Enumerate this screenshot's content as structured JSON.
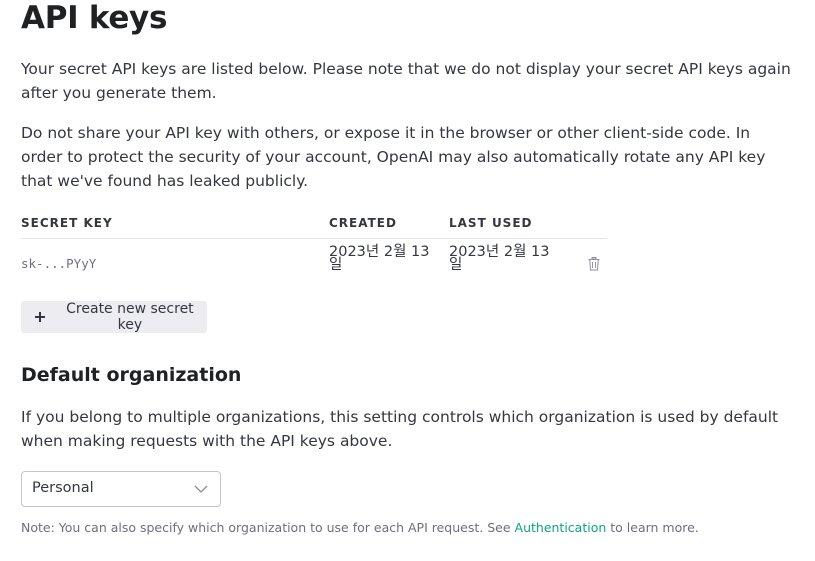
{
  "page": {
    "title": "API keys",
    "intro_1": "Your secret API keys are listed below. Please note that we do not display your secret API keys again after you generate them.",
    "intro_2": "Do not share your API key with others, or expose it in the browser or other client-side code. In order to protect the security of your account, OpenAI may also automatically rotate any API key that we've found has leaked publicly."
  },
  "keys_table": {
    "headers": {
      "secret_key": "SECRET KEY",
      "created": "CREATED",
      "last_used": "LAST USED"
    },
    "rows": [
      {
        "secret_key": "sk-...PYyY",
        "created": "2023년 2월 13일",
        "last_used": "2023년 2월 13일",
        "action_icon": "trash-icon"
      }
    ]
  },
  "create_button": {
    "label": "Create new secret key",
    "icon": "plus-icon"
  },
  "default_org": {
    "heading": "Default organization",
    "description": "If you belong to multiple organizations, this setting controls which organization is used by default when making requests with the API keys above.",
    "selected": "Personal"
  },
  "note": {
    "prefix": "Note: You can also specify which organization to use for each API request. See ",
    "link": "Authentication",
    "suffix": " to learn more."
  },
  "colors": {
    "link": "#10a37f",
    "button_bg": "#ececf1",
    "text": "#353740"
  }
}
